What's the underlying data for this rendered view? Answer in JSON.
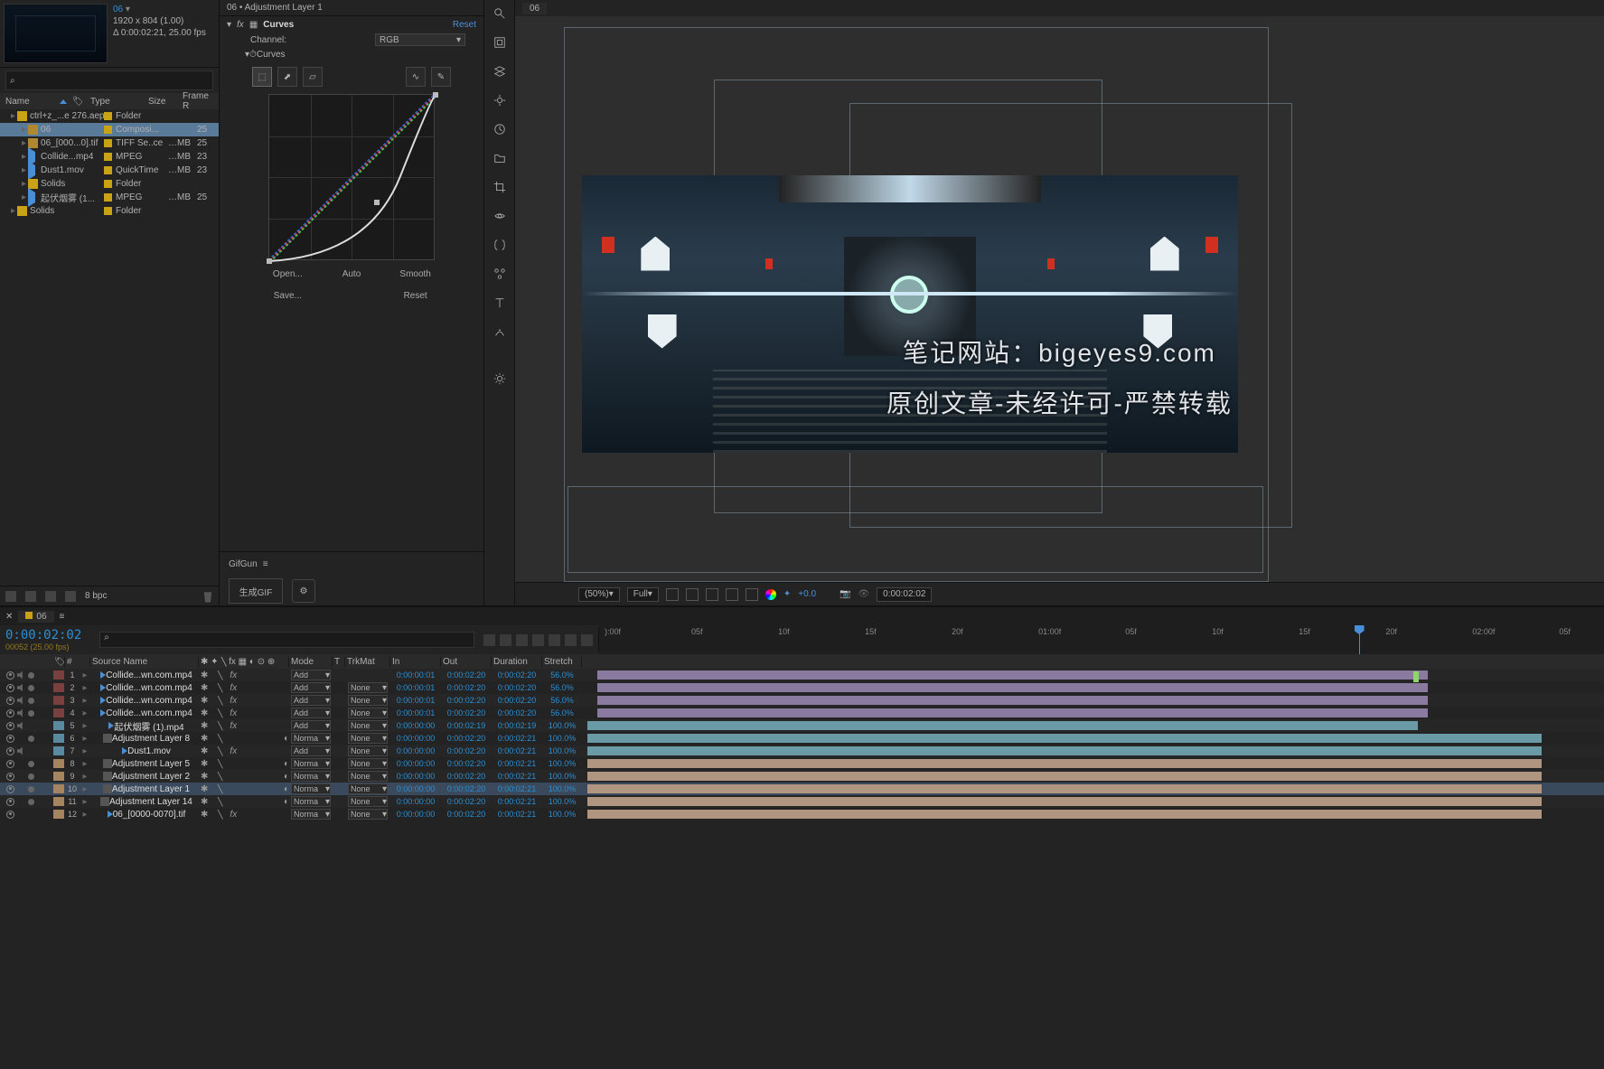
{
  "thumb": {
    "title": "06",
    "dims": "1920 x 804 (1.00)",
    "dur": "Δ 0:00:02:21, 25.00 fps"
  },
  "projectHeaders": {
    "name": "Name",
    "type": "Type",
    "size": "Size",
    "frame": "Frame R"
  },
  "projectItems": [
    {
      "indent": 0,
      "icon": "folder",
      "tag": true,
      "name": "ctrl+z_...e 276.aep",
      "type": "Folder",
      "size": "",
      "fr": ""
    },
    {
      "indent": 1,
      "icon": "comp",
      "tag": true,
      "name": "06",
      "type": "Composi...",
      "size": "",
      "fr": "25",
      "sel": true
    },
    {
      "indent": 1,
      "icon": "comp",
      "tag": true,
      "name": "06_[000...0].tif",
      "type": "TIFF Se..ce",
      "size": "…MB",
      "fr": "25"
    },
    {
      "indent": 1,
      "icon": "vid",
      "tag": true,
      "name": "Collide...mp4",
      "type": "MPEG",
      "size": "…MB",
      "fr": "23"
    },
    {
      "indent": 1,
      "icon": "vid",
      "tag": true,
      "name": "Dust1.mov",
      "type": "QuickTime",
      "size": "…MB",
      "fr": "23"
    },
    {
      "indent": 1,
      "icon": "folder",
      "tag": true,
      "name": "Solids",
      "type": "Folder",
      "size": "",
      "fr": ""
    },
    {
      "indent": 1,
      "icon": "vid",
      "tag": true,
      "name": "起伏烟雾 (1...",
      "type": "MPEG",
      "size": "…MB",
      "fr": "25"
    },
    {
      "indent": 0,
      "icon": "folder",
      "tag": true,
      "name": "Solids",
      "type": "Folder",
      "size": "",
      "fr": ""
    }
  ],
  "bpc": "8 bpc",
  "effect": {
    "title": "06 • Adjustment Layer 1",
    "name": "Curves",
    "reset": "Reset",
    "channelLabel": "Channel:",
    "channelValue": "RGB",
    "curvesLabel": "Curves",
    "btns": {
      "open": "Open...",
      "auto": "Auto",
      "smooth": "Smooth",
      "save": "Save...",
      "reset": "Reset"
    }
  },
  "gifgun": {
    "title": "GifGun",
    "make": "生成GIF"
  },
  "viewerTab": "06",
  "overlay1": "笔记网站：bigeyes9.com",
  "overlay2": "原创文章-未经许可-严禁转载",
  "viewerCtrl": {
    "zoom": "(50%)",
    "res": "Full",
    "exposure": "+0.0",
    "tc": "0:00:02:02"
  },
  "timeline": {
    "tab": "06",
    "tc": "0:00:02:02",
    "sub": "00052 (25.00 fps)",
    "ruler": [
      "):00f",
      "05f",
      "10f",
      "15f",
      "20f",
      "01:00f",
      "05f",
      "10f",
      "15f",
      "20f",
      "02:00f",
      "05f"
    ],
    "ctiPos": 0.79,
    "columns": {
      "source": "Source Name",
      "mode": "Mode",
      "t": "T",
      "trk": "TrkMat",
      "in": "In",
      "out": "Out",
      "dur": "Duration",
      "str": "Stretch"
    },
    "layers": [
      {
        "n": 1,
        "color": "#7a3f3f",
        "icon": "vid",
        "name": "Collide...wn.com.mp4",
        "mode": "Add",
        "trk": "",
        "in": "0:00:00:01",
        "out": "0:00:02:20",
        "dur": "0:00:02:20",
        "str": "56.0%",
        "bar": "lav",
        "eye": true,
        "spk": true,
        "solo": true,
        "barStart": 0.01,
        "barEnd": 0.88
      },
      {
        "n": 2,
        "color": "#7a3f3f",
        "icon": "vid",
        "name": "Collide...wn.com.mp4",
        "mode": "Add",
        "trk": "None",
        "in": "0:00:00:01",
        "out": "0:00:02:20",
        "dur": "0:00:02:20",
        "str": "56.0%",
        "bar": "lav",
        "eye": true,
        "spk": true,
        "solo": true,
        "barStart": 0.01,
        "barEnd": 0.88
      },
      {
        "n": 3,
        "color": "#7a3f3f",
        "icon": "vid",
        "name": "Collide...wn.com.mp4",
        "mode": "Add",
        "trk": "None",
        "in": "0:00:00:01",
        "out": "0:00:02:20",
        "dur": "0:00:02:20",
        "str": "56.0%",
        "bar": "lav",
        "eye": true,
        "spk": true,
        "solo": true,
        "barStart": 0.01,
        "barEnd": 0.88
      },
      {
        "n": 4,
        "color": "#7a3f3f",
        "icon": "vid",
        "name": "Collide...wn.com.mp4",
        "mode": "Add",
        "trk": "None",
        "in": "0:00:00:01",
        "out": "0:00:02:20",
        "dur": "0:00:02:20",
        "str": "56.0%",
        "bar": "lav",
        "eye": true,
        "spk": true,
        "solo": true,
        "barStart": 0.01,
        "barEnd": 0.88
      },
      {
        "n": 5,
        "color": "#5a8aa0",
        "icon": "vid",
        "name": "起伏烟雾 (1).mp4",
        "mode": "Add",
        "trk": "None",
        "in": "0:00:00:00",
        "out": "0:00:02:19",
        "dur": "0:00:02:19",
        "str": "100.0%",
        "bar": "cyan",
        "eye": true,
        "spk": true,
        "solo": false,
        "barStart": 0,
        "barEnd": 0.87
      },
      {
        "n": 6,
        "color": "#5a8aa0",
        "icon": "adj",
        "name": "Adjustment Layer 8",
        "mode": "Norma",
        "trk": "None",
        "in": "0:00:00:00",
        "out": "0:00:02:20",
        "dur": "0:00:02:21",
        "str": "100.0%",
        "bar": "cyan",
        "eye": true,
        "solo": true,
        "moon": true,
        "barStart": 0,
        "barEnd": 1
      },
      {
        "n": 7,
        "color": "#5a8aa0",
        "icon": "vid",
        "name": "Dust1.mov",
        "mode": "Add",
        "trk": "None",
        "in": "0:00:00:00",
        "out": "0:00:02:20",
        "dur": "0:00:02:21",
        "str": "100.0%",
        "bar": "cyan",
        "eye": true,
        "spk": true,
        "barStart": 0,
        "barEnd": 1
      },
      {
        "n": 8,
        "color": "#a58560",
        "icon": "adj",
        "name": "Adjustment Layer 5",
        "mode": "Norma",
        "trk": "None",
        "in": "0:00:00:00",
        "out": "0:00:02:20",
        "dur": "0:00:02:21",
        "str": "100.0%",
        "bar": "peach",
        "eye": true,
        "solo": true,
        "moon": true,
        "barStart": 0,
        "barEnd": 1
      },
      {
        "n": 9,
        "color": "#a58560",
        "icon": "adj",
        "name": "Adjustment Layer 2",
        "mode": "Norma",
        "trk": "None",
        "in": "0:00:00:00",
        "out": "0:00:02:20",
        "dur": "0:00:02:21",
        "str": "100.0%",
        "bar": "peach",
        "eye": true,
        "solo": true,
        "moon": true,
        "barStart": 0,
        "barEnd": 1
      },
      {
        "n": 10,
        "color": "#a58560",
        "icon": "adj",
        "name": "Adjustment Layer 1",
        "mode": "Norma",
        "trk": "None",
        "in": "0:00:00:00",
        "out": "0:00:02:20",
        "dur": "0:00:02:21",
        "str": "100.0%",
        "bar": "peach",
        "eye": true,
        "solo": true,
        "moon": true,
        "sel": true,
        "barStart": 0,
        "barEnd": 1
      },
      {
        "n": 11,
        "color": "#a58560",
        "icon": "adj",
        "name": "Adjustment Layer 14",
        "mode": "Norma",
        "trk": "None",
        "in": "0:00:00:00",
        "out": "0:00:02:20",
        "dur": "0:00:02:21",
        "str": "100.0%",
        "bar": "peach",
        "eye": true,
        "solo": true,
        "moon": true,
        "barStart": 0,
        "barEnd": 1
      },
      {
        "n": 12,
        "color": "#a58560",
        "icon": "vid",
        "name": "06_[0000-0070].tif",
        "mode": "Norma",
        "trk": "None",
        "in": "0:00:00:00",
        "out": "0:00:02:20",
        "dur": "0:00:02:21",
        "str": "100.0%",
        "bar": "peach",
        "eye": true,
        "barStart": 0,
        "barEnd": 1
      }
    ]
  }
}
